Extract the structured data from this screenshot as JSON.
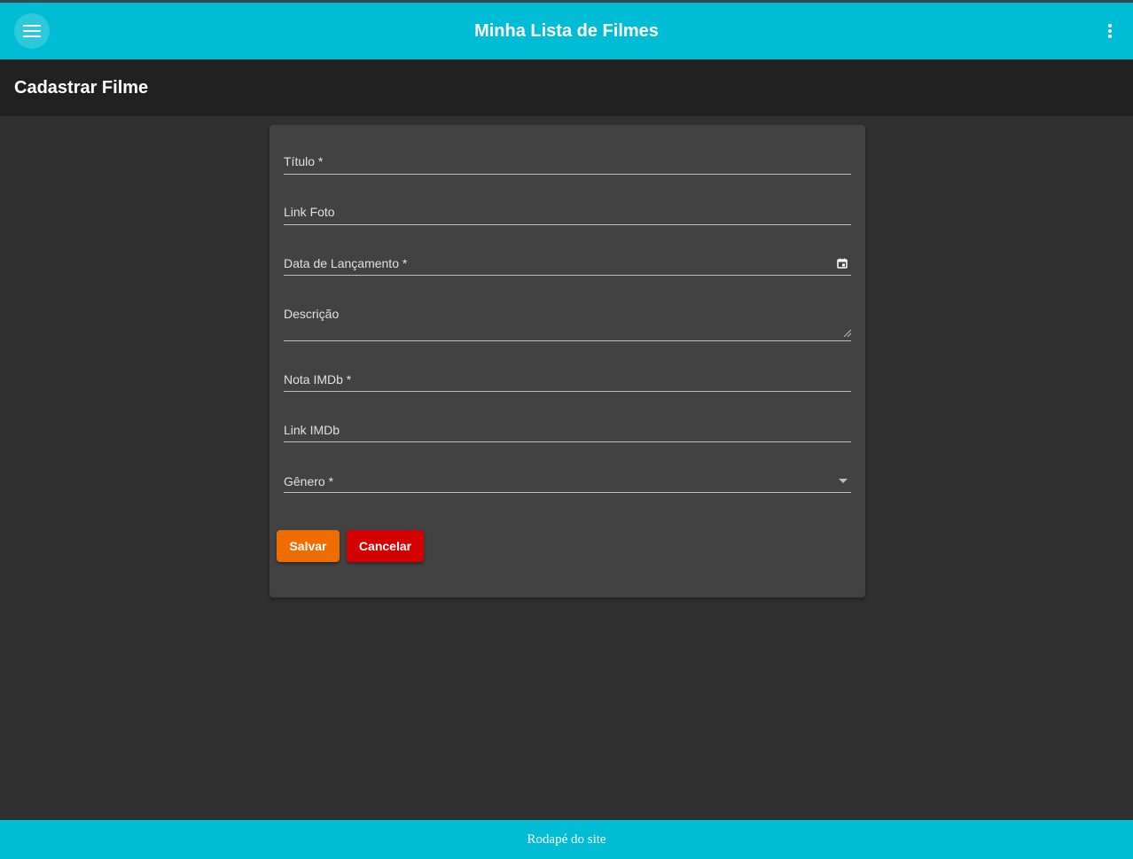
{
  "appbar": {
    "title": "Minha Lista de Filmes",
    "menu_icon": "menu-icon",
    "more_icon": "more-vert-icon"
  },
  "subheader": {
    "title": "Cadastrar Filme"
  },
  "form": {
    "fields": [
      {
        "label": "Título *",
        "value": ""
      },
      {
        "label": "Link Foto",
        "value": ""
      },
      {
        "label": "Data de Lançamento *",
        "value": "",
        "icon": "calendar-icon"
      },
      {
        "label": "Descrição",
        "value": ""
      },
      {
        "label": "Nota IMDb *",
        "value": ""
      },
      {
        "label": "Link IMDb",
        "value": ""
      },
      {
        "label": "Gênero *",
        "value": "",
        "icon": "dropdown-arrow-icon"
      }
    ],
    "save_label": "Salvar",
    "cancel_label": "Cancelar"
  },
  "footer": {
    "text": "Rodapé do site"
  },
  "colors": {
    "primary": "#00bcd4",
    "save": "#ef6c00",
    "cancel": "#d50000",
    "background": "#303030",
    "card": "#424242"
  }
}
